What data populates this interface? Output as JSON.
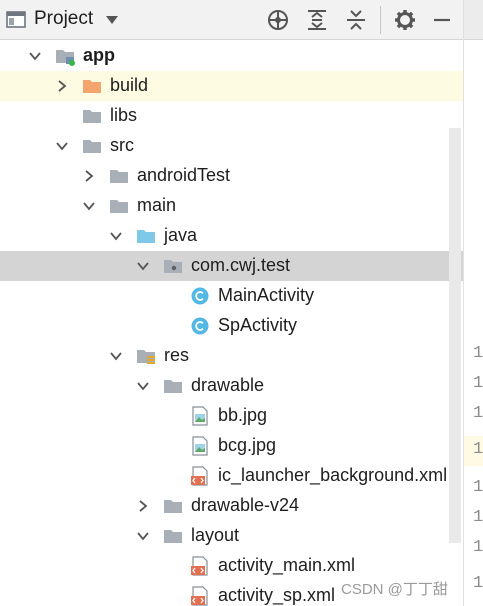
{
  "header": {
    "title": "Project",
    "icons": [
      "window-icon",
      "dropdown-icon",
      "locate-icon",
      "expand-all-icon",
      "collapse-all-icon",
      "gear-icon",
      "minimize-icon"
    ]
  },
  "tree": {
    "rows": [
      {
        "label": "app",
        "bold": true,
        "icon": "module-folder"
      },
      {
        "label": "build",
        "icon": "folder-orange"
      },
      {
        "label": "libs",
        "icon": "folder-grey"
      },
      {
        "label": "src",
        "icon": "folder-grey"
      },
      {
        "label": "androidTest",
        "icon": "folder-grey"
      },
      {
        "label": "main",
        "icon": "folder-grey"
      },
      {
        "label": "java",
        "icon": "folder-blue"
      },
      {
        "label": "com.cwj.test",
        "icon": "package-folder"
      },
      {
        "label": "MainActivity",
        "icon": "class-c"
      },
      {
        "label": "SpActivity",
        "icon": "class-c"
      },
      {
        "label": "res",
        "icon": "res-folder"
      },
      {
        "label": "drawable",
        "icon": "folder-grey"
      },
      {
        "label": "bb.jpg",
        "icon": "image-file"
      },
      {
        "label": "bcg.jpg",
        "icon": "image-file"
      },
      {
        "label": "ic_launcher_background.xml",
        "icon": "xml-file"
      },
      {
        "label": "drawable-v24",
        "icon": "folder-grey"
      },
      {
        "label": "layout",
        "icon": "folder-grey"
      },
      {
        "label": "activity_main.xml",
        "icon": "xml-file"
      },
      {
        "label": "activity_sp.xml",
        "icon": "xml-file"
      }
    ]
  },
  "editor": {
    "line_digits": [
      "1",
      "1",
      "1",
      "1",
      "1",
      "1",
      "1",
      "1"
    ]
  },
  "colors": {
    "selected_row": "#d4d4d4",
    "highlight_row": "#fefbe3",
    "folder_grey": "#a9afb6",
    "folder_blue": "#7ec8e8",
    "folder_orange": "#f4a56d",
    "class_icon": "#54b8e5",
    "xml_icon": "#e26f4f"
  },
  "watermark": "CSDN @丁丁甜"
}
